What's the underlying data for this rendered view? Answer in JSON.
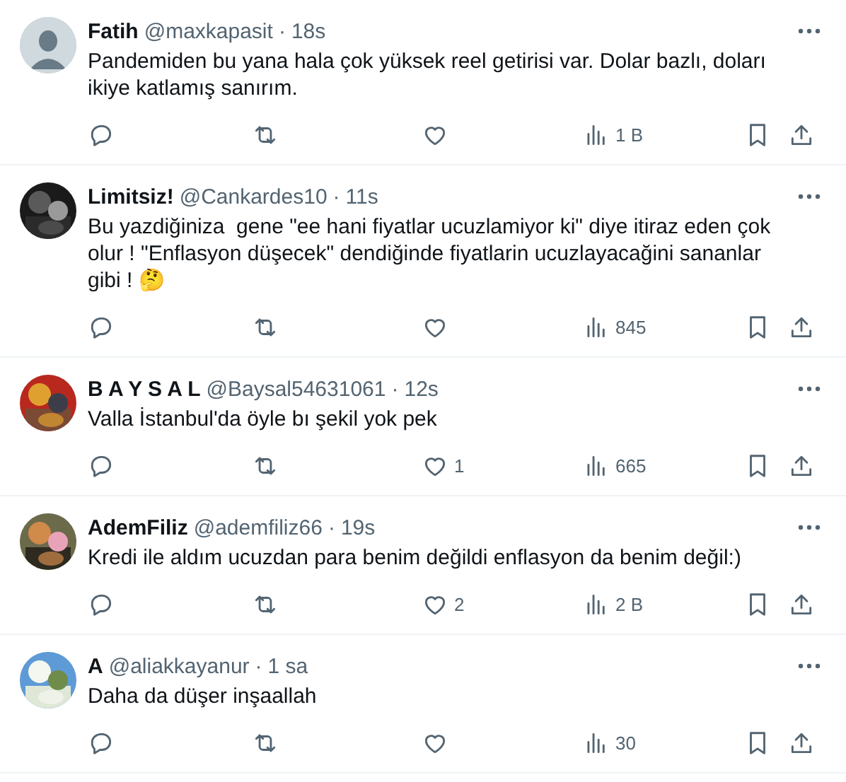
{
  "replies": [
    {
      "name": "Fatih",
      "handle": "@maxkapasit",
      "separator": "·",
      "time": "18s",
      "avatar": {
        "kind": "default"
      },
      "text": "Pandemiden bu yana hala çok yüksek reel getirisi var. Dolar bazlı, doları ikiye katlamış sanırım.",
      "views": "1 B"
    },
    {
      "name": "Limitsiz!",
      "handle": "@Cankardes10",
      "separator": "·",
      "time": "11s",
      "text": "Bu yazdiğiniza  gene \"ee hani fiyatlar ucuzlamiyor ki\" diye itiraz eden çok olur ! \"Enflasyon düşecek\" dendiğinde fiyatlarin ucuzlayacağini sananlar gibi ! 🤔",
      "views": "845"
    },
    {
      "name": "B A Y S A L",
      "handle": "@Baysal54631061",
      "separator": "·",
      "time": "12s",
      "text": "Valla İstanbul'da öyle bı şekil yok pek",
      "likes": "1",
      "views": "665"
    },
    {
      "name": "AdemFiliz",
      "handle": "@ademfiliz66",
      "separator": "·",
      "time": "19s",
      "text": "Kredi ile aldım ucuzdan para benim değildi enflasyon da benim değil:)",
      "likes": "2",
      "views": "2 B"
    },
    {
      "name": "A",
      "handle": "@aliakkayanur",
      "separator": "·",
      "time": "1 sa",
      "text": "Daha da düşer inşaallah",
      "views": "30"
    }
  ]
}
